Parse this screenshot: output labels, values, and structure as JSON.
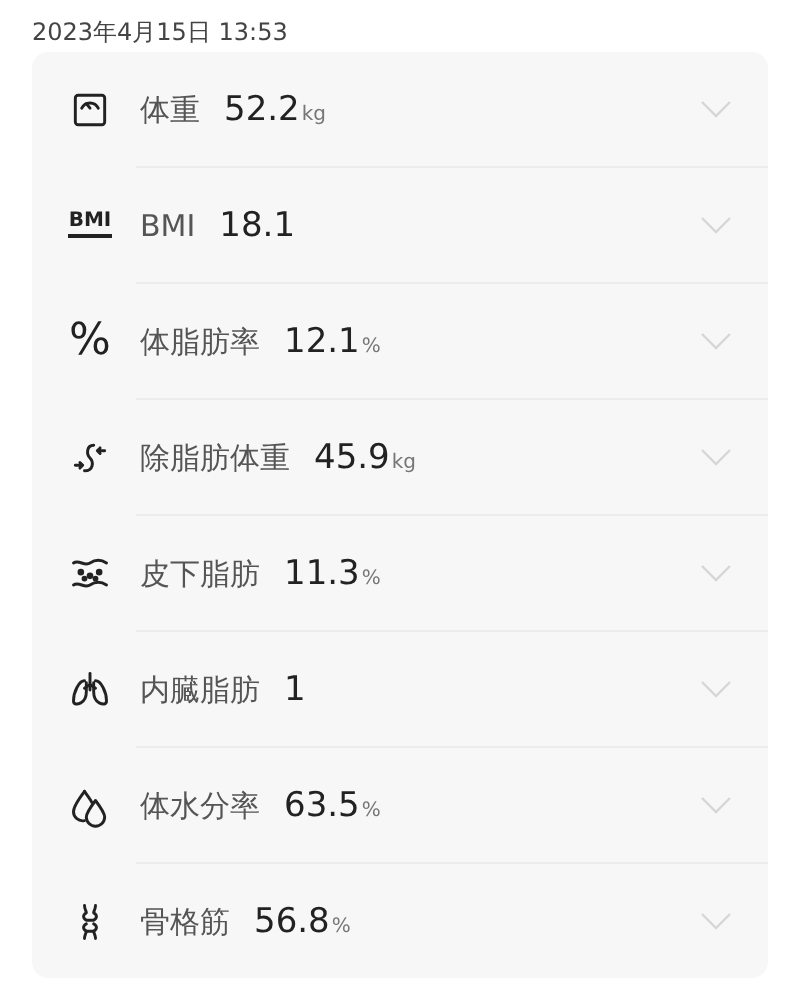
{
  "timestamp": "2023年4月15日 13:53",
  "rows": [
    {
      "kind": "scale",
      "label": "体重",
      "value": "52.2",
      "unit": "kg"
    },
    {
      "kind": "bmi",
      "icon_text": "BMI",
      "label": "BMI",
      "value": "18.1"
    },
    {
      "kind": "percent",
      "icon_text": "%",
      "label": "体脂肪率",
      "value": "12.1",
      "unit": "%"
    },
    {
      "kind": "lean",
      "label": "除脂肪体重",
      "value": "45.9",
      "unit": "kg"
    },
    {
      "kind": "subcutaneous",
      "label": "皮下脂肪",
      "value": "11.3",
      "unit": "%"
    },
    {
      "kind": "visceral",
      "label": "内臓脂肪",
      "value": "1"
    },
    {
      "kind": "water",
      "label": "体水分率",
      "value": "63.5",
      "unit": "%"
    },
    {
      "kind": "bone",
      "label": "骨格筋",
      "value": "56.8",
      "unit": "%"
    }
  ]
}
